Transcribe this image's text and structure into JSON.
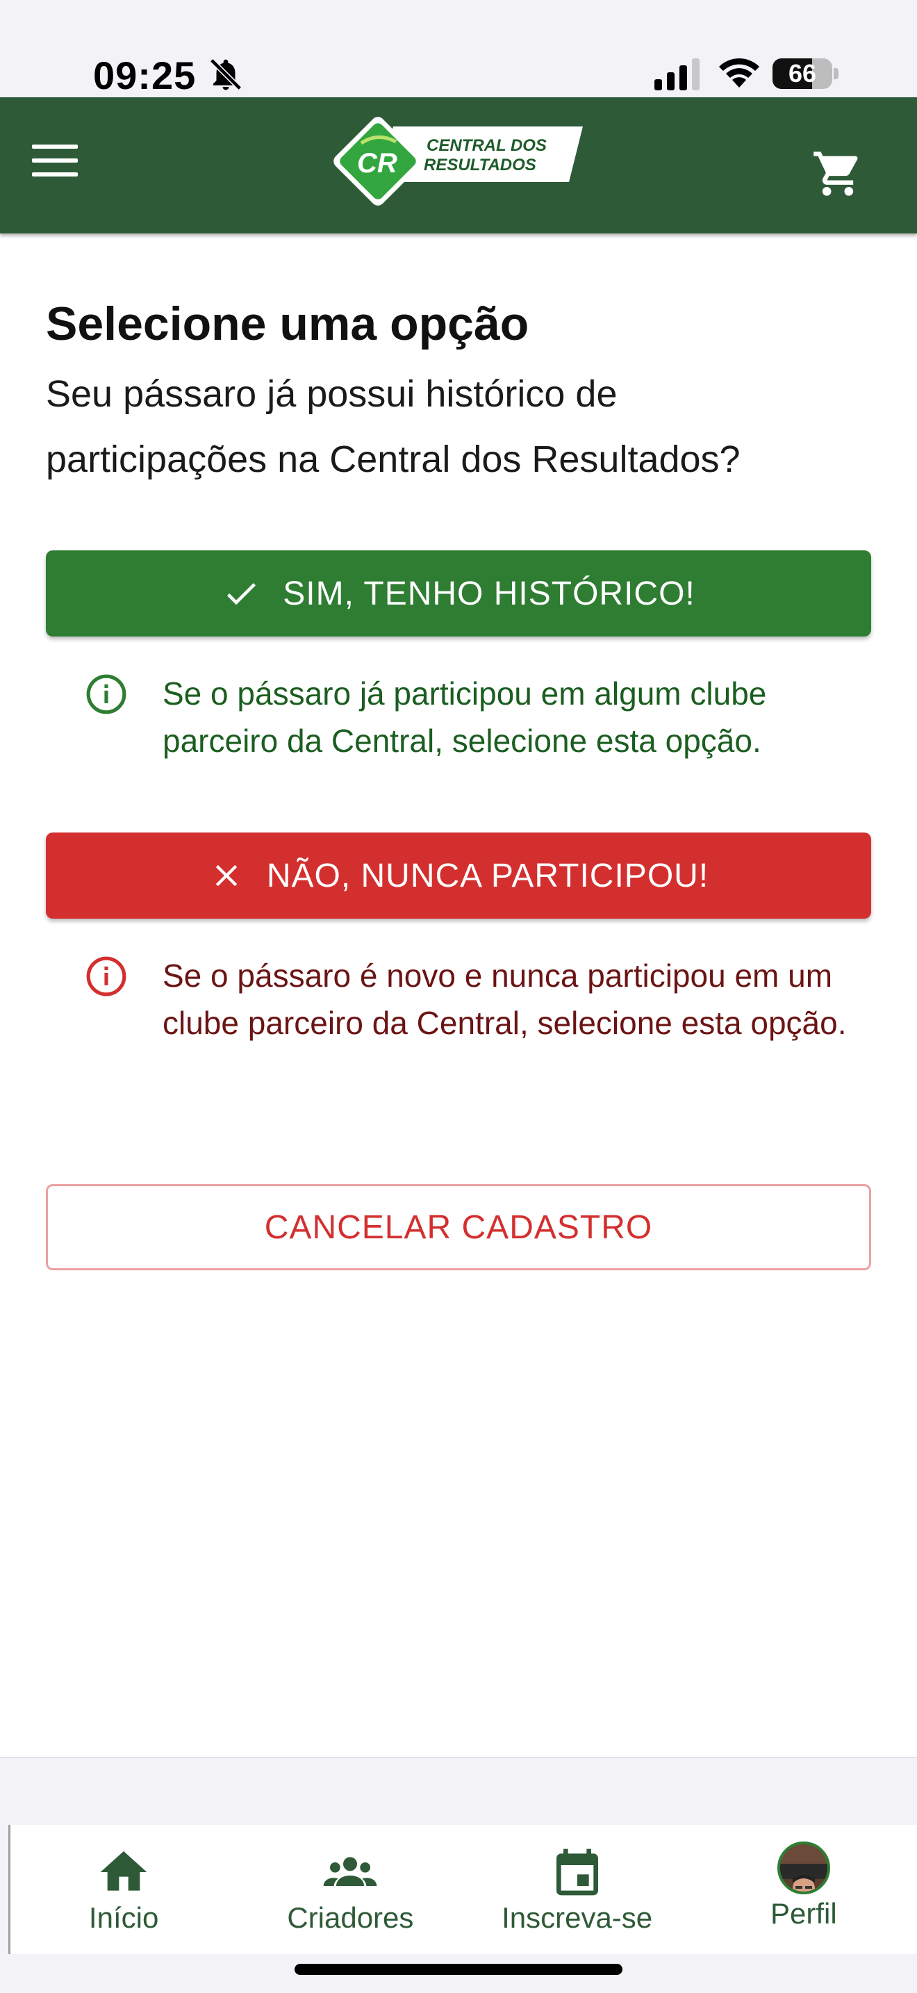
{
  "status_bar": {
    "time": "09:25",
    "battery_level": "66",
    "battery_fraction": 0.66
  },
  "header": {
    "logo_mark": "CR",
    "logo_line1": "CENTRAL DOS",
    "logo_line2": "RESULTADOS",
    "menu_icon": "hamburger-menu-icon",
    "cart_icon": "shopping-cart-icon"
  },
  "content": {
    "title": "Selecione uma opção",
    "subtitle": "Seu pássaro já possui histórico de participações na Central dos Resultados?",
    "yes_button": "SIM, TENHO HISTÓRICO!",
    "yes_hint": "Se o pássaro já participou em algum clube parceiro da Central, selecione esta opção.",
    "no_button": "NÃO, NUNCA PARTICIPOU!",
    "no_hint": "Se o pássaro é novo e nunca participou em um clube parceiro da Central, selecione esta opção.",
    "cancel_button": "CANCELAR CADASTRO"
  },
  "colors": {
    "header_bg": "#2e5a37",
    "success": "#2e7d32",
    "danger": "#d32f2f",
    "success_text": "#1b5e20",
    "danger_text": "#6b1414"
  },
  "bottom_nav": {
    "items": [
      {
        "label": "Início",
        "icon": "home-icon"
      },
      {
        "label": "Criadores",
        "icon": "people-icon"
      },
      {
        "label": "Inscreva-se",
        "icon": "calendar-icon"
      },
      {
        "label": "Perfil",
        "icon": "avatar"
      }
    ]
  }
}
